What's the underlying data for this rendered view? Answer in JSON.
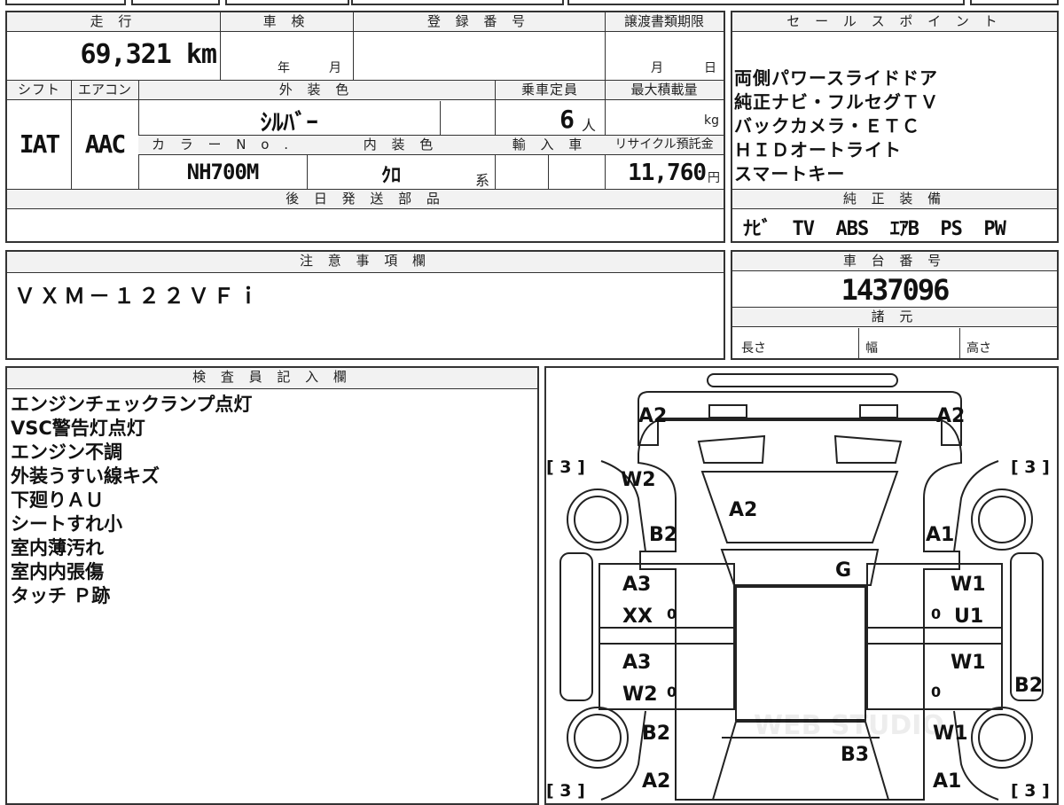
{
  "top_table": {
    "mileage_label": "走 行",
    "mileage_value": "69,321 km",
    "inspection_label": "車 検",
    "inspection_year": "年",
    "inspection_month": "月",
    "reg_number_label": "登 録 番 号",
    "transfer_deadline_label": "譲渡書類期限",
    "transfer_month": "月",
    "transfer_day": "日",
    "shift_label": "シフト",
    "shift_value": "IAT",
    "aircon_label": "エアコン",
    "aircon_value": "AAC",
    "exterior_color_label": "外 装 色",
    "exterior_color_value": "ｼﾙﾊﾞｰ",
    "capacity_label": "乗車定員",
    "capacity_value": "6",
    "capacity_unit": "人",
    "max_load_label": "最大積載量",
    "max_load_unit": "kg",
    "color_no_label": "カ ラ ー N o .",
    "color_no_value": "NH700M",
    "interior_color_label": "内 装 色",
    "interior_color_value": "ｸﾛ",
    "interior_color_suffix": "系",
    "import_label": "輸 入 車",
    "recycle_label": "リサイクル預託金",
    "recycle_value": "11,760",
    "recycle_unit": "円",
    "later_parts_label": "後 日 発 送 部 品"
  },
  "sales_points": {
    "label": "セ ー ル ス ポ イ ン ト",
    "items": [
      "両側パワースライドドア",
      "純正ナビ・フルセグＴＶ",
      "バックカメラ・ＥＴＣ",
      "ＨＩＤオートライト",
      "スマートキー"
    ]
  },
  "equipment": {
    "label": "純 正 装 備",
    "value": "ﾅﾋﾞ  TV  ABS  ｴｱB  PS  PW"
  },
  "notes": {
    "label": "注 意 事 項 欄",
    "value": "ＶＸＭ－１２２ＶＦｉ"
  },
  "chassis": {
    "label": "車 台 番 号",
    "value": "1437096",
    "specs_label": "諸 元",
    "length_label": "長さ",
    "width_label": "幅",
    "height_label": "高さ"
  },
  "inspector": {
    "label": "検 査 員 記 入 欄",
    "items": [
      "エンジンチェックランプ点灯",
      "VSC警告灯点灯",
      "エンジン不調",
      "外装うすい線キズ",
      "下廻りＡＵ",
      "シートすれ小",
      "室内薄汚れ",
      "室内内張傷",
      "タッチ Ｐ跡"
    ]
  },
  "diagram": {
    "tire_front_left": "[ 3 ]",
    "tire_front_right": "[ 3 ]",
    "tire_rear_left": "[ 3 ]",
    "tire_rear_right": "[ 3 ]",
    "front_bumper_left": "A2",
    "front_bumper_right": "A2",
    "left_fender": "W2",
    "left_fender_lower": "B2",
    "hood": "A2",
    "right_fender": "A1",
    "roof": "G",
    "left_front_door_1": "A3",
    "left_front_door_2": "XX",
    "left_front_door_mark": "0",
    "right_front_door_1": "W1",
    "right_front_door_2": "U1",
    "right_front_door_mark": "0",
    "left_rear_door_1": "A3",
    "left_rear_door_2": "W2",
    "left_rear_door_mark": "0",
    "right_rear_door_1": "W1",
    "right_rear_door_mark": "0",
    "right_side_panel": "B2",
    "left_quarter": "B2",
    "right_quarter": "W1",
    "back_door": "B3",
    "rear_bumper_left": "A2",
    "rear_bumper_right": "A1",
    "watermark": "WEB STUDIO"
  }
}
